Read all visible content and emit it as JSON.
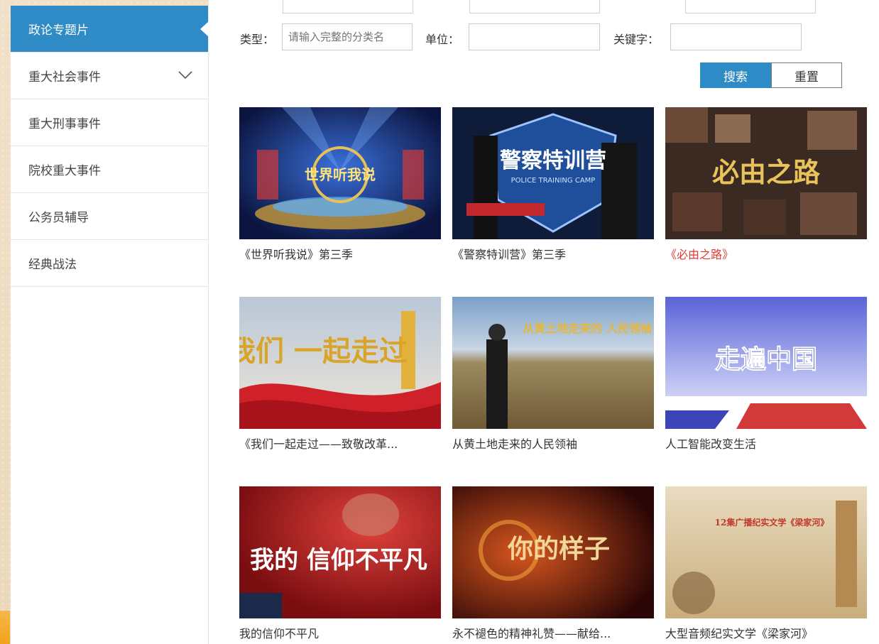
{
  "sidebar": {
    "items": [
      {
        "label": "政论专题片",
        "active": true
      },
      {
        "label": "重大社会事件",
        "has_submenu": true
      },
      {
        "label": "重大刑事事件"
      },
      {
        "label": "院校重大事件"
      },
      {
        "label": "公务员辅导"
      },
      {
        "label": "经典战法"
      }
    ]
  },
  "filters": {
    "type_label": "类型：",
    "type_placeholder": "请输入完整的分类名",
    "unit_label": "单位：",
    "unit_value": "",
    "keyword_label": "关键字：",
    "keyword_value": "",
    "search_button": "搜索",
    "reset_button": "重置"
  },
  "videos": [
    {
      "title": "《世界听我说》第三季",
      "thumb_text": "世界听我说",
      "highlight": false
    },
    {
      "title": "《警察特训营》第三季",
      "thumb_text": "警察特训营",
      "thumb_subtext": "POLICE TRAINING CAMP",
      "highlight": false
    },
    {
      "title": "《必由之路》",
      "thumb_text": "必由之路",
      "highlight": true
    },
    {
      "title": "《我们一起走过——致敬改革...",
      "thumb_text": "我们 一起走过",
      "highlight": false
    },
    {
      "title": "从黄土地走来的人民领袖",
      "thumb_text": "从黄土地走来的 人民领袖",
      "highlight": false
    },
    {
      "title": "人工智能改变生活",
      "thumb_text": "走遍中国",
      "highlight": false
    },
    {
      "title": "我的信仰不平凡",
      "thumb_text": "我的 信仰不平凡",
      "highlight": false
    },
    {
      "title": "永不褪色的精神礼赞——献给...",
      "thumb_text": "你的样子",
      "highlight": false
    },
    {
      "title": "大型音频纪实文学《梁家河》",
      "thumb_text": "12集广播纪实文学《梁家河》",
      "highlight": false
    }
  ],
  "colors": {
    "accent": "#2e8bc6",
    "highlight_title": "#e03a32"
  }
}
